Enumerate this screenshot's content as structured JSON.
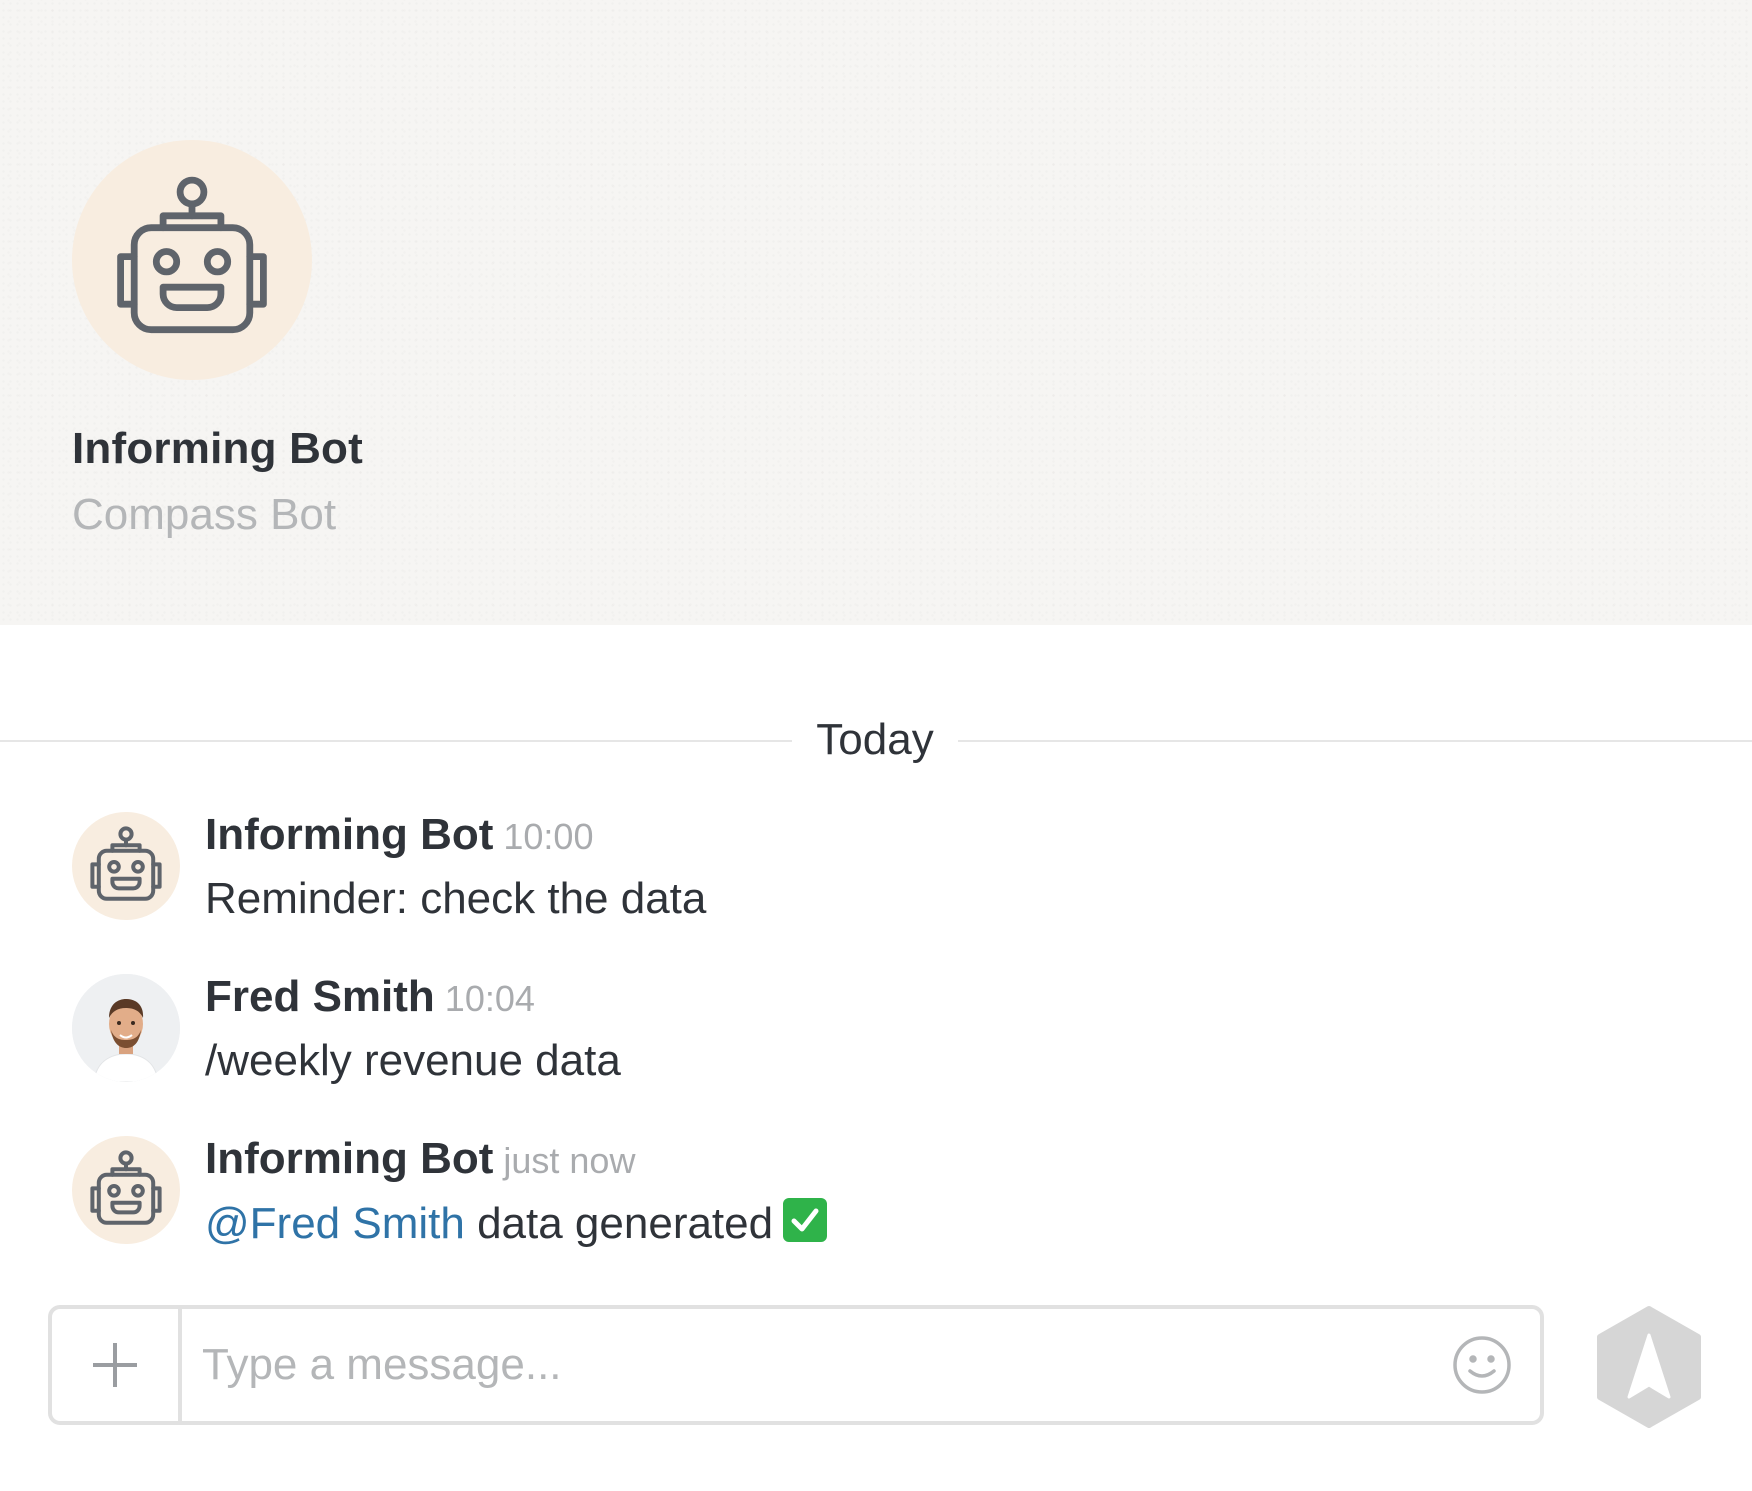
{
  "profile": {
    "name": "Informing Bot",
    "subtitle": "Compass Bot",
    "avatar_icon": "robot-icon"
  },
  "divider": {
    "label": "Today"
  },
  "messages": [
    {
      "author": "Informing Bot",
      "time": "10:00",
      "avatar_icon": "robot-icon",
      "text": "Reminder: check the data"
    },
    {
      "author": "Fred Smith",
      "time": "10:04",
      "avatar_icon": "user-photo",
      "text": "/weekly revenue data"
    },
    {
      "author": "Informing Bot",
      "time": "just now",
      "avatar_icon": "robot-icon",
      "mention": "@Fred Smith",
      "text": " data generated",
      "emoji": "check-mark-icon"
    }
  ],
  "composer": {
    "placeholder": "Type a message...",
    "attach_icon": "plus-icon",
    "emoji_icon": "smiley-icon",
    "send_icon": "send-arrow-icon"
  },
  "colors": {
    "accent_mention": "#2f73a7",
    "avatar_bg": "#f8ede0",
    "check_green": "#2fb34a",
    "send_button": "#d6d6d6"
  }
}
